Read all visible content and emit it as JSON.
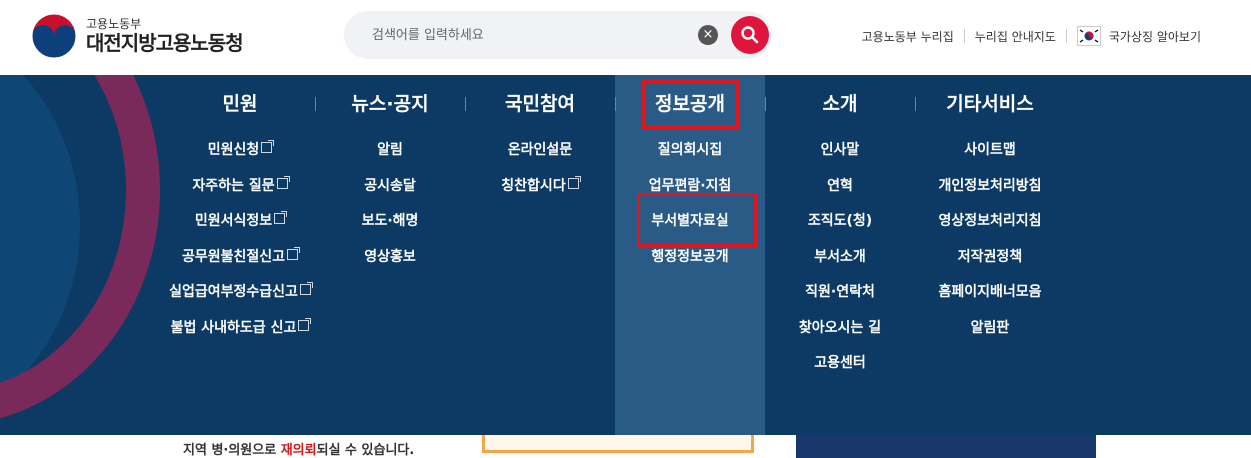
{
  "header": {
    "logo_small": "고용노동부",
    "logo_big": "대전지방고용노동청",
    "search_placeholder": "검색어를 입력하세요",
    "util_links": [
      "고용노동부 누리집",
      "누리집 안내지도"
    ],
    "national_symbol_label": "국가상징 알아보기"
  },
  "menu": {
    "active_index": 3,
    "columns": [
      {
        "title": "민원",
        "items": [
          {
            "label": "민원신청",
            "ext": true
          },
          {
            "label": "자주하는 질문",
            "ext": true
          },
          {
            "label": "민원서식정보",
            "ext": true
          },
          {
            "label": "공무원불친절신고",
            "ext": true
          },
          {
            "label": "실업급여부정수급신고",
            "ext": true
          },
          {
            "label": "불법 사내하도급 신고",
            "ext": true
          }
        ]
      },
      {
        "title": "뉴스·공지",
        "items": [
          {
            "label": "알림",
            "ext": false
          },
          {
            "label": "공시송달",
            "ext": false
          },
          {
            "label": "보도·해명",
            "ext": false
          },
          {
            "label": "영상홍보",
            "ext": false
          }
        ]
      },
      {
        "title": "국민참여",
        "items": [
          {
            "label": "온라인설문",
            "ext": false
          },
          {
            "label": "칭찬합시다",
            "ext": true
          }
        ]
      },
      {
        "title": "정보공개",
        "items": [
          {
            "label": "질의회시집",
            "ext": false
          },
          {
            "label": "업무편람·지침",
            "ext": false
          },
          {
            "label": "부서별자료실",
            "ext": false
          },
          {
            "label": "행정정보공개",
            "ext": false
          }
        ]
      },
      {
        "title": "소개",
        "items": [
          {
            "label": "인사말",
            "ext": false
          },
          {
            "label": "연혁",
            "ext": false
          },
          {
            "label": "조직도(청)",
            "ext": false
          },
          {
            "label": "부서소개",
            "ext": false
          },
          {
            "label": "직원·연락처",
            "ext": false
          },
          {
            "label": "찾아오시는 길",
            "ext": false
          },
          {
            "label": "고용센터",
            "ext": false
          }
        ]
      },
      {
        "title": "기타서비스",
        "items": [
          {
            "label": "사이트맵",
            "ext": false
          },
          {
            "label": "개인정보처리방침",
            "ext": false
          },
          {
            "label": "영상정보처리지침",
            "ext": false
          },
          {
            "label": "저작권정책",
            "ext": false
          },
          {
            "label": "홈페이지배너모음",
            "ext": false
          },
          {
            "label": "알림판",
            "ext": false
          }
        ]
      }
    ]
  },
  "below": {
    "text_before": "지역 병·의원으로 ",
    "text_red": "재의뢰",
    "text_after": "되실 수 있습니다."
  },
  "colors": {
    "menu_bg": "#0c3a64",
    "active_col_bg": "#2a5b86",
    "search_btn": "#e0153e",
    "highlight": "#e0151e"
  },
  "icons": [
    "taegeuk-logo-icon",
    "clear-icon",
    "search-icon",
    "korean-flag-icon",
    "external-link-icon"
  ]
}
